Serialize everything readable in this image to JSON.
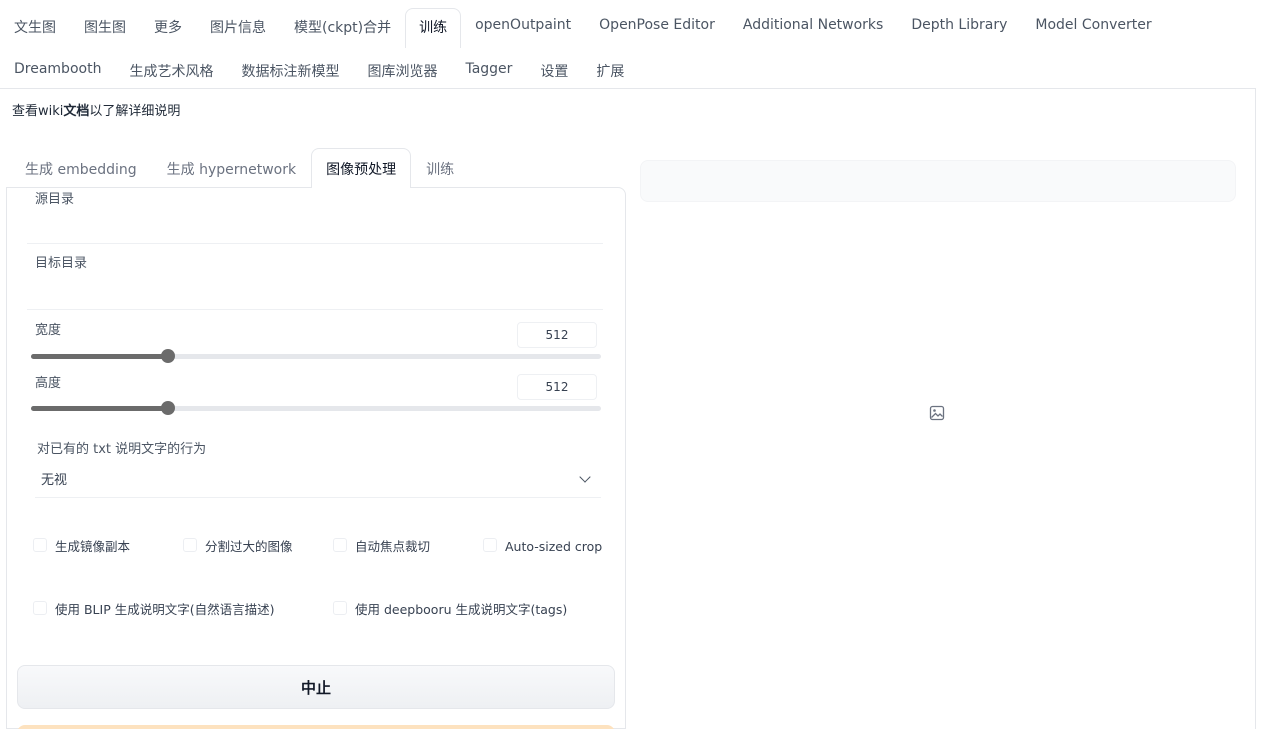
{
  "top_tabs": [
    {
      "label": "文生图"
    },
    {
      "label": "图生图"
    },
    {
      "label": "更多"
    },
    {
      "label": "图片信息"
    },
    {
      "label": "模型(ckpt)合并"
    },
    {
      "label": "训练",
      "active": true
    },
    {
      "label": "openOutpaint"
    },
    {
      "label": "OpenPose Editor"
    },
    {
      "label": "Additional Networks"
    },
    {
      "label": "Depth Library"
    },
    {
      "label": "Model Converter"
    },
    {
      "label": "Dreambooth"
    },
    {
      "label": "生成艺术风格"
    },
    {
      "label": "数据标注新模型"
    },
    {
      "label": "图库浏览器"
    },
    {
      "label": "Tagger"
    },
    {
      "label": "设置"
    },
    {
      "label": "扩展"
    }
  ],
  "wiki_note": {
    "prefix": "查看wiki",
    "bold": "文档",
    "suffix": "以了解详细说明"
  },
  "sub_tabs": [
    {
      "label": "生成 embedding"
    },
    {
      "label": "生成 hypernetwork"
    },
    {
      "label": "图像预处理",
      "active": true
    },
    {
      "label": "训练"
    }
  ],
  "preprocess": {
    "source_dir_label": "源目录",
    "source_dir_value": "",
    "target_dir_label": "目标目录",
    "target_dir_value": "",
    "width_label": "宽度",
    "width_value": "512",
    "width_fraction": 0.24,
    "height_label": "高度",
    "height_value": "512",
    "height_fraction": 0.24,
    "caption_action_label": "对已有的 txt 说明文字的行为",
    "caption_action_value": "无视",
    "checkboxes": {
      "flip": "生成镜像副本",
      "split": "分割过大的图像",
      "focal": "自动焦点裁切",
      "autosize": "Auto-sized crop",
      "blip": "使用 BLIP 生成说明文字(自然语言描述)",
      "deepbooru": "使用 deepbooru 生成说明文字(tags)"
    },
    "stop_label": "中止"
  },
  "colors": {
    "slider_fill": "#6b6b6b",
    "accent_strip": "#fde2bf"
  },
  "icons": {
    "image_placeholder": "image-icon"
  }
}
